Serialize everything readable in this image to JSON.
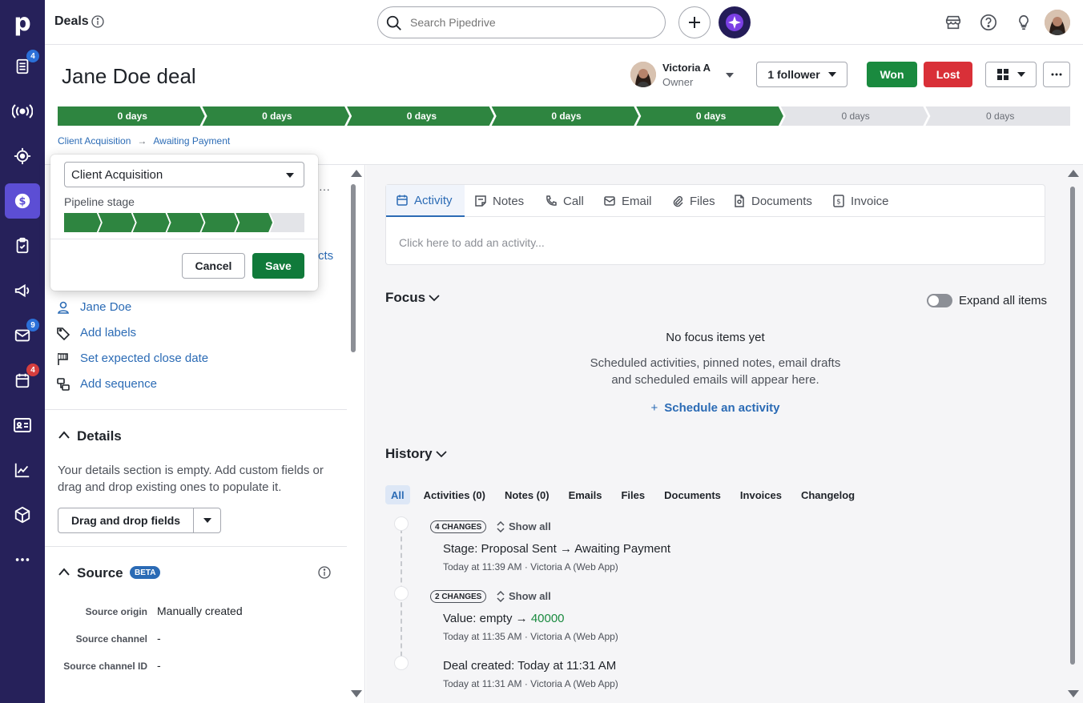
{
  "nav": {
    "logo": "p",
    "badges": {
      "leads": "4",
      "mail": "9",
      "calendar": "4"
    }
  },
  "topbar": {
    "title": "Deals",
    "search_placeholder": "Search Pipedrive"
  },
  "deal": {
    "title": "Jane Doe deal",
    "owner_name": "Victoria A",
    "owner_role": "Owner",
    "followers_label": "1 follower",
    "won_label": "Won",
    "lost_label": "Lost"
  },
  "stages": [
    {
      "label": "0 days",
      "status": "done"
    },
    {
      "label": "0 days",
      "status": "done"
    },
    {
      "label": "0 days",
      "status": "done"
    },
    {
      "label": "0 days",
      "status": "done"
    },
    {
      "label": "0 days",
      "status": "done"
    },
    {
      "label": "0 days",
      "status": "todo"
    },
    {
      "label": "0 days",
      "status": "todo"
    }
  ],
  "breadcrumb": {
    "pipeline": "Client Acquisition",
    "stage": "Awaiting Payment"
  },
  "popover": {
    "pipeline_value": "Client Acquisition",
    "pipeline_stage_label": "Pipeline stage",
    "stages_done": 6,
    "stages_total": 7,
    "cancel_label": "Cancel",
    "save_label": "Save"
  },
  "leftpanel": {
    "partial_link": "cts",
    "links": {
      "person": "Jane Doe",
      "labels": "Add labels",
      "close_date": "Set expected close date",
      "sequence": "Add sequence"
    },
    "details": {
      "title": "Details",
      "empty_text": "Your details section is empty. Add custom fields or drag and drop existing ones to populate it.",
      "drag_button": "Drag and drop fields"
    },
    "source": {
      "title": "Source",
      "beta": "BETA",
      "rows": [
        {
          "label": "Source origin",
          "value": "Manually created"
        },
        {
          "label": "Source channel",
          "value": "-"
        },
        {
          "label": "Source channel ID",
          "value": "-"
        }
      ]
    }
  },
  "activity": {
    "tabs": [
      "Activity",
      "Notes",
      "Call",
      "Email",
      "Files",
      "Documents",
      "Invoice"
    ],
    "placeholder": "Click here to add an activity..."
  },
  "focus": {
    "title": "Focus",
    "expand_label": "Expand all items",
    "empty_title": "No focus items yet",
    "empty_line1": "Scheduled activities, pinned notes, email drafts",
    "empty_line2": "and scheduled emails will appear here.",
    "schedule_label": "Schedule an activity"
  },
  "history": {
    "title": "History",
    "tabs": [
      "All",
      "Activities (0)",
      "Notes (0)",
      "Emails",
      "Files",
      "Documents",
      "Invoices",
      "Changelog"
    ],
    "show_all": "Show all",
    "entries": [
      {
        "chip": "4 CHANGES",
        "field": "Stage",
        "from": "Proposal Sent",
        "to": "Awaiting Payment",
        "meta": "Today at 11:39 AM · Victoria A (Web App)"
      },
      {
        "chip": "2 CHANGES",
        "field": "Value",
        "from": "empty",
        "to": "40000",
        "meta": "Today at 11:35 AM · Victoria A (Web App)"
      },
      {
        "field": "Deal created",
        "value": "Today at 11:31 AM",
        "meta": "Today at 11:31 AM · Victoria A (Web App)"
      }
    ]
  }
}
